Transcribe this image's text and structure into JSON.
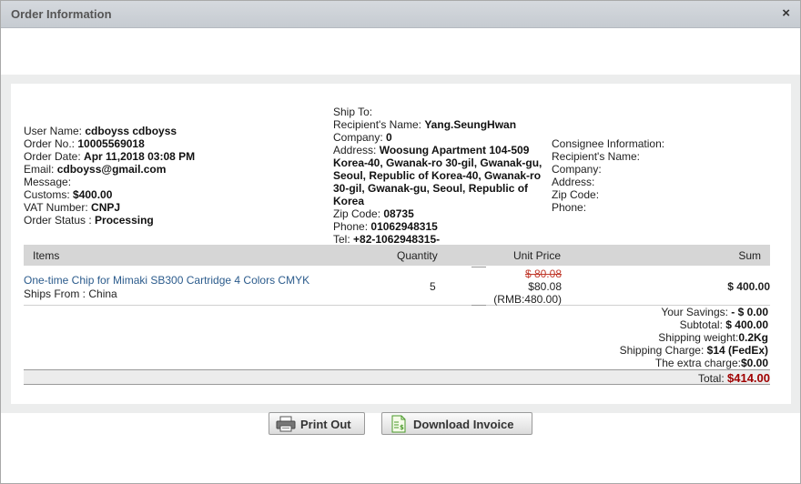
{
  "window": {
    "title": "Order Information",
    "close_glyph": "×"
  },
  "user": {
    "name_label": "User Name:",
    "name_value": "cdboyss cdboyss",
    "order_no_label": "Order No.:",
    "order_no_value": "10005569018",
    "order_date_label": "Order Date:",
    "order_date_value": "Apr 11,2018 03:08 PM",
    "email_label": "Email:",
    "email_value": "cdboyss@gmail.com",
    "message_label": "Message:",
    "customs_label": "Customs:",
    "customs_value": "$400.00",
    "vat_label": "VAT Number:",
    "vat_value": "CNPJ",
    "status_label": "Order Status :",
    "status_value": "Processing"
  },
  "ship_to": {
    "heading": "Ship To:",
    "recipient_label": "Recipient's Name:",
    "recipient_value": "Yang.SeungHwan",
    "company_label": "Company:",
    "company_value": "0",
    "address_label": "Address:",
    "address_value": "Woosung Apartment 104-509  Korea-40, Gwanak-ro 30-gil, Gwanak-gu, Seoul, Republic of Korea-40, Gwanak-ro 30-gil, Gwanak-gu, Seoul, Republic of Korea",
    "zip_label": "Zip Code:",
    "zip_value": "08735",
    "phone_label": "Phone:",
    "phone_value": "01062948315",
    "tel_label": "Tel:",
    "tel_value": "+82-1062948315-"
  },
  "consignee": {
    "heading": "Consignee Information:",
    "recipient_label": "Recipient's Name:",
    "company_label": "Company:",
    "address_label": "Address:",
    "zip_label": "Zip Code:",
    "phone_label": "Phone:"
  },
  "table": {
    "headers": {
      "items": "Items",
      "quantity": "Quantity",
      "unit_price": "Unit Price",
      "sum": "Sum"
    },
    "rows": [
      {
        "product": "One-time Chip for Mimaki SB300 Cartridge 4 Colors CMYK",
        "ships_from": "Ships From : China",
        "quantity": "5",
        "old_price": "$ 80.08",
        "price": "$80.08",
        "rmb": "(RMB:480.00)",
        "sum": "$ 400.00"
      }
    ]
  },
  "totals": {
    "savings_label": "Your Savings:",
    "savings_value": "- $ 0.00",
    "subtotal_label": "Subtotal:",
    "subtotal_value": "$ 400.00",
    "weight_label": "Shipping weight:",
    "weight_value": "0.2Kg",
    "charge_label": "Shipping Charge:",
    "charge_value": "$14 (FedEx)",
    "extra_label": "The extra charge:",
    "extra_value": "$0.00",
    "total_label": "Total:",
    "total_value": "$414.00"
  },
  "buttons": {
    "print": "Print Out",
    "invoice": "Download Invoice"
  },
  "icons": {
    "print": "printer-icon",
    "invoice": "invoice-icon",
    "close": "close-icon"
  },
  "colors": {
    "link": "#2b5b8c",
    "total": "#a00000",
    "strike": "#c0392b"
  }
}
